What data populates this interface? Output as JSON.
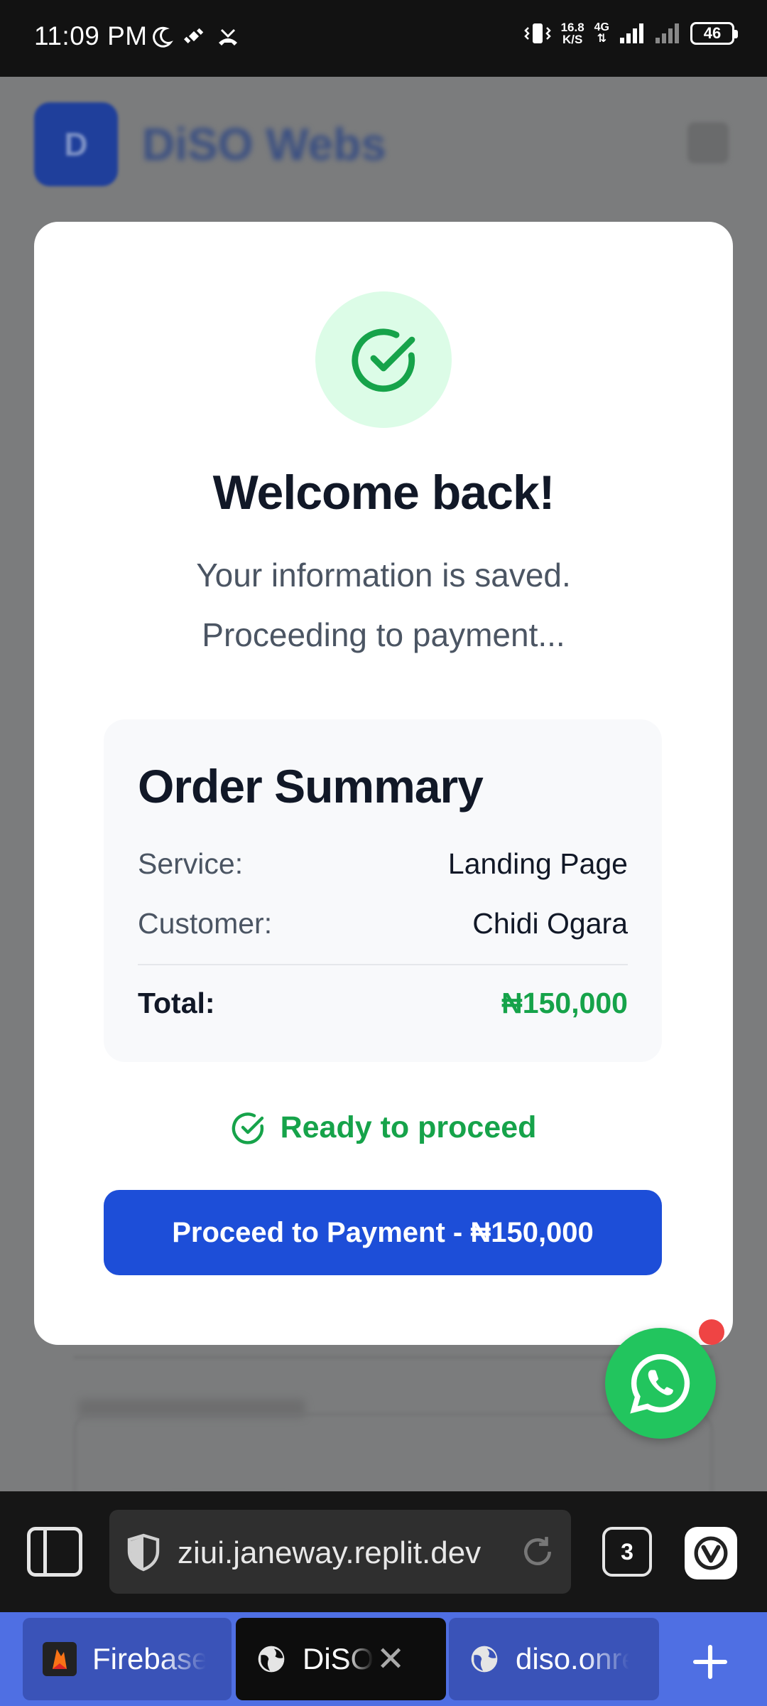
{
  "status_bar": {
    "time": "11:09 PM",
    "speed_value": "16.8",
    "speed_unit": "K/S",
    "network": "4G",
    "battery": "46"
  },
  "background_page": {
    "logo_letter": "D",
    "brand": "DiSO Webs"
  },
  "modal": {
    "title": "Welcome back!",
    "subtitle_line1": "Your information is saved.",
    "subtitle_line2": "Proceeding to payment...",
    "summary": {
      "title": "Order Summary",
      "service_label": "Service:",
      "service_value": "Landing Page",
      "customer_label": "Customer:",
      "customer_value": "Chidi Ogara",
      "total_label": "Total:",
      "total_value": "₦150,000"
    },
    "ready_text": "Ready to proceed",
    "proceed_button": "Proceed to Payment - ₦150,000"
  },
  "browser": {
    "url": "ziui.janeway.replit.dev",
    "tab_count": "3",
    "tabs": [
      {
        "label": "Firebase"
      },
      {
        "label": "DiSO W"
      },
      {
        "label": "diso.onre"
      }
    ]
  },
  "colors": {
    "accent_blue": "#1d4ed8",
    "success_green": "#16a34a",
    "whatsapp_green": "#22c55e",
    "tab_strip": "#4f6fe3"
  }
}
